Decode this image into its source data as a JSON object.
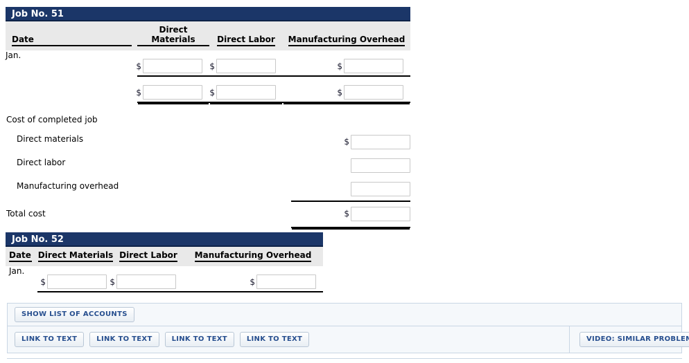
{
  "colors": {
    "header_bar": "#1b3668",
    "header_bar_underline": "#0d2247",
    "column_header_bg": "#e9e9e9",
    "panel_bg": "#f5f8fb",
    "panel_border": "#c9d6e4",
    "button_text": "#274f8f",
    "field_border": "#c8c8c8"
  },
  "job51": {
    "title": "Job No. 51",
    "columns": [
      "Date",
      "Direct Materials",
      "Direct Labor",
      "Manufacturing Overhead"
    ],
    "rows": [
      {
        "date": "Jan.",
        "cells": [
          {
            "dollar": "$",
            "value": "",
            "rule": "single"
          },
          {
            "dollar": "$",
            "value": "",
            "rule": "single"
          },
          {
            "dollar": "$",
            "value": "",
            "rule": "single"
          }
        ]
      },
      {
        "date": "",
        "cells": [
          {
            "dollar": "$",
            "value": "",
            "rule": "double"
          },
          {
            "dollar": "$",
            "value": "",
            "rule": "double"
          },
          {
            "dollar": "$",
            "value": "",
            "rule": "double"
          }
        ]
      }
    ]
  },
  "summary": {
    "heading": "Cost of completed job",
    "rows": [
      {
        "label": "Direct materials",
        "indent": true,
        "dollar": "$",
        "value": "",
        "rule": "none"
      },
      {
        "label": "Direct labor",
        "indent": true,
        "dollar": "",
        "value": "",
        "rule": "none"
      },
      {
        "label": "Manufacturing overhead",
        "indent": true,
        "dollar": "",
        "value": "",
        "rule": "single"
      },
      {
        "label": "Total cost",
        "indent": false,
        "dollar": "$",
        "value": "",
        "rule": "double"
      }
    ]
  },
  "job52": {
    "title": "Job No. 52",
    "columns": [
      "Date",
      "Direct Materials",
      "Direct Labor",
      "Manufacturing Overhead"
    ],
    "rows": [
      {
        "date": "Jan.",
        "cells": [
          {
            "dollar": "$",
            "value": "",
            "rule": "single"
          },
          {
            "dollar": "$",
            "value": "",
            "rule": "single"
          },
          {
            "dollar": "$",
            "value": "",
            "rule": "single"
          }
        ]
      }
    ]
  },
  "actions": {
    "show_list_of_accounts": "SHOW LIST OF ACCOUNTS",
    "link_buttons": [
      "LINK TO TEXT",
      "LINK TO TEXT",
      "LINK TO TEXT",
      "LINK TO TEXT"
    ],
    "video_button": "VIDEO: SIMILAR PROBLEM"
  }
}
